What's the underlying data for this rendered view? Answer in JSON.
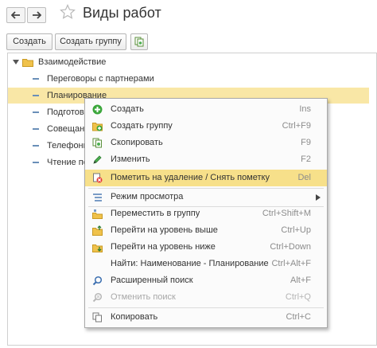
{
  "header": {
    "title": "Виды работ",
    "back_icon": "arrow-left-icon",
    "forward_icon": "arrow-right-icon",
    "favorite_icon": "star-outline-icon"
  },
  "toolbar": {
    "create_label": "Создать",
    "create_group_label": "Создать группу",
    "copy_icon": "copy-document-icon"
  },
  "tree": {
    "root_label": "Взаимодействие",
    "items": [
      {
        "label": "Переговоры с партнерами"
      },
      {
        "label": "Планирование"
      },
      {
        "label": "Подготовка"
      },
      {
        "label": "Совещани"
      },
      {
        "label": "Телефонн"
      },
      {
        "label": "Чтение поч"
      }
    ]
  },
  "context_menu": {
    "items": [
      {
        "label": "Создать",
        "shortcut": "Ins",
        "icon": "add-icon"
      },
      {
        "label": "Создать группу",
        "shortcut": "Ctrl+F9",
        "icon": "add-group-icon"
      },
      {
        "label": "Скопировать",
        "shortcut": "F9",
        "icon": "copy-icon"
      },
      {
        "label": "Изменить",
        "shortcut": "F2",
        "icon": "pencil-icon"
      },
      {
        "label": "Пометить на удаление / Снять пометку",
        "shortcut": "Del",
        "icon": "mark-delete-icon"
      },
      {
        "label": "Режим просмотра",
        "shortcut": "",
        "icon": "view-mode-icon"
      },
      {
        "label": "Переместить в группу",
        "shortcut": "Ctrl+Shift+M",
        "icon": "move-to-group-icon"
      },
      {
        "label": "Перейти на уровень выше",
        "shortcut": "Ctrl+Up",
        "icon": "level-up-icon"
      },
      {
        "label": "Перейти на уровень ниже",
        "shortcut": "Ctrl+Down",
        "icon": "level-down-icon"
      },
      {
        "label": "Найти: Наименование - Планирование",
        "shortcut": "Ctrl+Alt+F",
        "icon": ""
      },
      {
        "label": "Расширенный поиск",
        "shortcut": "Alt+F",
        "icon": "search-icon"
      },
      {
        "label": "Отменить поиск",
        "shortcut": "Ctrl+Q",
        "icon": "cancel-search-icon"
      },
      {
        "label": "Копировать",
        "shortcut": "Ctrl+C",
        "icon": "clipboard-copy-icon"
      }
    ]
  },
  "colors": {
    "selection": "#f9e7a6",
    "menu_highlight": "#f7e08a",
    "tree_dash": "#6a8fb8",
    "folder": "#f0c24b"
  }
}
